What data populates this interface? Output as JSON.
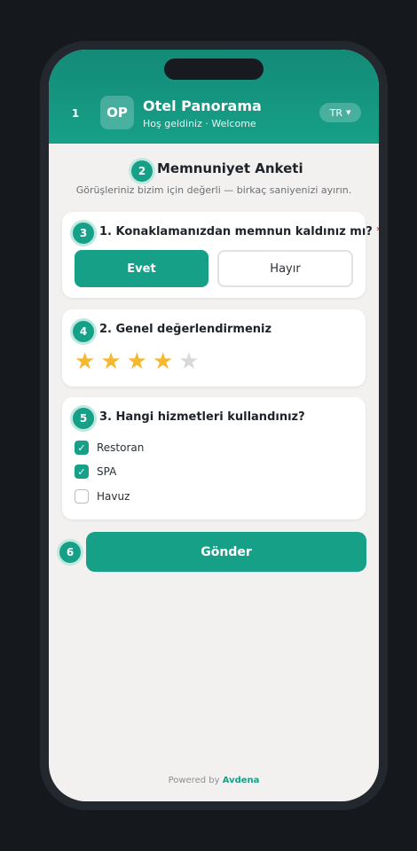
{
  "markers": {
    "m1": "1",
    "m2": "2",
    "m3": "3",
    "m4": "4",
    "m5": "5",
    "m6": "6"
  },
  "header": {
    "logo_initials": "OP",
    "title": "Otel Panorama",
    "subtitle": "Hoş geldiniz · Welcome",
    "language": "TR",
    "language_icon": "chevron-down-icon"
  },
  "survey": {
    "title": "Memnuniyet Anketi",
    "subtitle": "Görüşleriniz bizim için değerli — birkaç saniyenizi ayırın."
  },
  "q1": {
    "title": "1. Konaklamanızdan memnun kaldınız mı?",
    "required_mark": "*",
    "yes": "Evet",
    "no": "Hayır",
    "selected": "Evet"
  },
  "q2": {
    "title": "2. Genel değerlendirmeniz",
    "rating": 4,
    "max": 5,
    "star_glyph": "★"
  },
  "q3": {
    "title": "3. Hangi hizmetleri kullandınız?",
    "options": [
      {
        "label": "Restoran",
        "checked": true
      },
      {
        "label": "SPA",
        "checked": true
      },
      {
        "label": "Havuz",
        "checked": false
      }
    ],
    "check_glyph": "✓"
  },
  "submit": {
    "label": "Gönder"
  },
  "footer": {
    "prefix": "Powered by",
    "brand": "Avdena"
  },
  "colors": {
    "accent": "#17a088",
    "star": "#f5b82e",
    "required": "#d64040"
  }
}
